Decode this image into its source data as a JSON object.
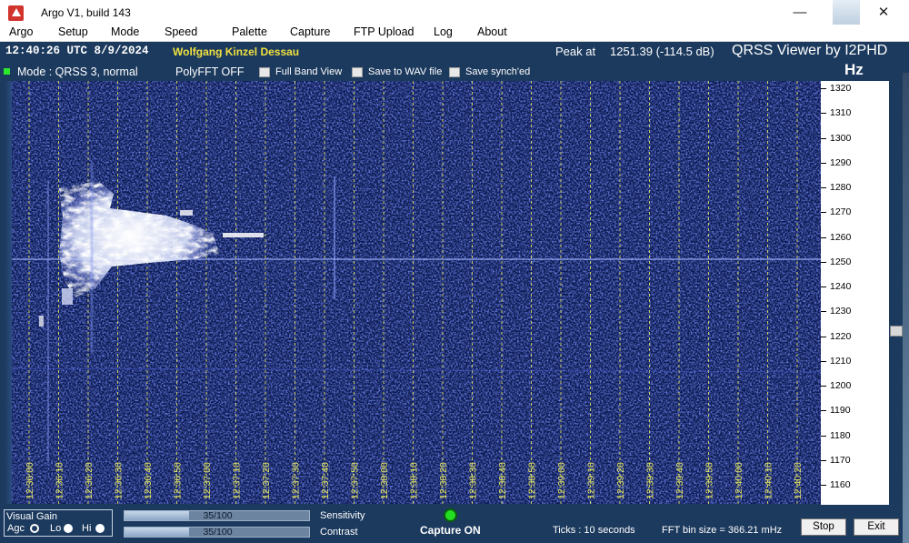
{
  "window": {
    "title": "Argo V1, build 143",
    "minimize_glyph": "—",
    "close_glyph": "✕"
  },
  "menu": [
    "Argo",
    "Setup",
    "Mode",
    "Speed",
    "Palette",
    "Capture",
    "FTP Upload",
    "Log",
    "About"
  ],
  "header": {
    "clock": "12:40:26 UTC  8/9/2024",
    "station": "Wolfgang Kinzel Dessau",
    "peak_label": "Peak at",
    "peak_value": "1251.39 (-114.5 dB)",
    "viewer_title": "QRSS Viewer by I2PHD",
    "unit": "Hz",
    "mode": "Mode : QRSS 3, normal",
    "polyfft": "PolyFFT OFF",
    "options": [
      {
        "label": "Full Band View",
        "checked": false
      },
      {
        "label": "Save to WAV file",
        "checked": false
      },
      {
        "label": "Save synch'ed",
        "checked": false
      }
    ]
  },
  "waterfall": {
    "time_labels": [
      "12:36:00",
      "12:36:10",
      "12:36:20",
      "12:36:30",
      "12:36:40",
      "12:36:50",
      "12:37:00",
      "12:37:10",
      "12:37:20",
      "12:37:30",
      "12:37:40",
      "12:37:50",
      "12:38:00",
      "12:38:10",
      "12:38:20",
      "12:38:30",
      "12:38:40",
      "12:38:50",
      "12:39:00",
      "12:39:10",
      "12:39:20",
      "12:39:30",
      "12:39:40",
      "12:39:50",
      "12:40:00",
      "12:40:10",
      "12:40:20"
    ],
    "freq_labels": [
      "1320",
      "1310",
      "1300",
      "1290",
      "1280",
      "1270",
      "1260",
      "1250",
      "1240",
      "1230",
      "1220",
      "1210",
      "1200",
      "1190",
      "1180",
      "1170",
      "1160"
    ],
    "carrier_freq_hz": 1251.39,
    "colors": {
      "background": "#0d1b52",
      "signal": "#ffffff",
      "grid": "#e8e860"
    }
  },
  "controls": {
    "visual_gain": "Visual Gain",
    "agc": "Agc",
    "lo": "Lo",
    "hi": "Hi",
    "selected_gain_mode": "Agc",
    "sensitivity": {
      "label": "Sensitivity",
      "value": 35,
      "max": 100,
      "text": "35/100"
    },
    "contrast": {
      "label": "Contrast",
      "value": 35,
      "max": 100,
      "text": "35/100"
    },
    "capture_status": "Capture ON",
    "ticks": "Ticks  : 10 seconds",
    "fft_bin": "FFT bin size = 366.21 mHz",
    "stop": "Stop",
    "exit": "Exit"
  }
}
